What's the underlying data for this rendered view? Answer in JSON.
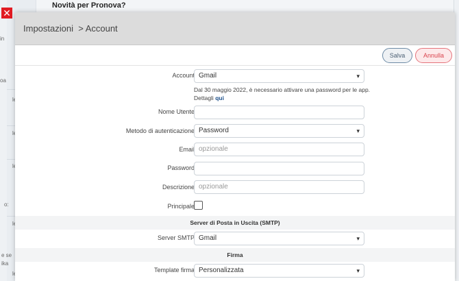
{
  "background": {
    "title": "Novità per Pronova?",
    "fragments": [
      "in",
      "oa",
      "le",
      "le",
      "le",
      "o:",
      "le",
      "e se",
      "ika",
      "le"
    ]
  },
  "close_icon": "close-x-icon",
  "modal": {
    "breadcrumb": "Impostazioni  > Account",
    "save_label": "Salva",
    "cancel_label": "Annulla"
  },
  "form": {
    "account": {
      "label": "Account",
      "value": "Gmail"
    },
    "note": {
      "text": "Dal 30 maggio 2022, è necessario attivare una password per le app. Dettagli ",
      "link": "qui"
    },
    "username": {
      "label": "Nome Utente",
      "value": ""
    },
    "auth_method": {
      "label": "Metodo di autenticazione",
      "value": "Password"
    },
    "email": {
      "label": "Email",
      "placeholder": "opzionale"
    },
    "password": {
      "label": "Password",
      "value": ""
    },
    "description": {
      "label": "Descrizione",
      "placeholder": "opzionale"
    },
    "primary": {
      "label": "Principale"
    },
    "smtp_section": "Server di Posta in Uscita (SMTP)",
    "smtp_server": {
      "label": "Server SMTP",
      "value": "Gmail"
    },
    "signature_section": "Firma",
    "signature_template": {
      "label": "Template firma",
      "value": "Personalizzata"
    }
  }
}
